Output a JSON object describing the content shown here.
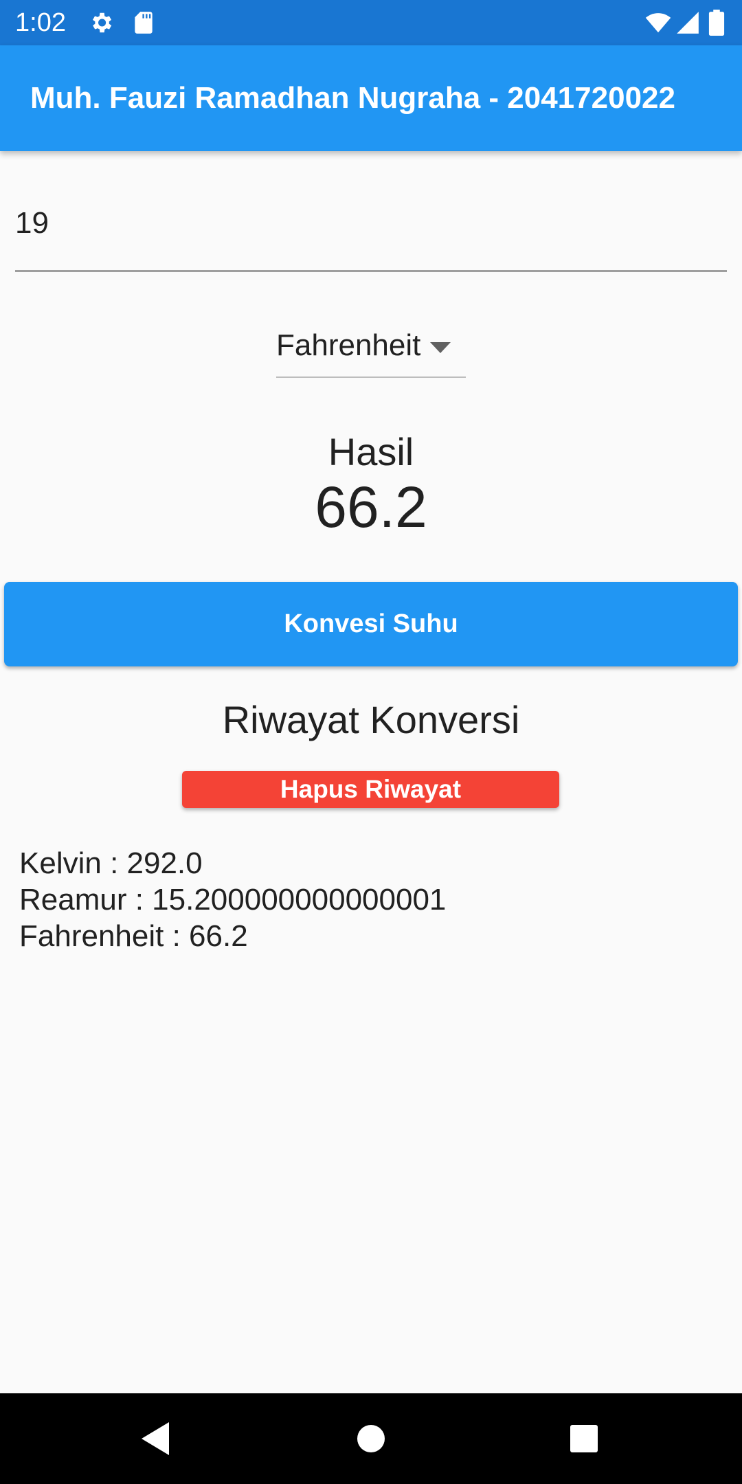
{
  "status_bar": {
    "time": "1:02",
    "icons": [
      "gear-icon",
      "sd-card-icon",
      "wifi-icon",
      "signal-icon",
      "battery-icon"
    ]
  },
  "app_bar": {
    "title": "Muh. Fauzi Ramadhan Nugraha - 2041720022"
  },
  "input": {
    "value": "19"
  },
  "dropdown": {
    "selected": "Fahrenheit"
  },
  "result": {
    "label": "Hasil",
    "value": "66.2"
  },
  "convert_button": {
    "label": "Konvesi Suhu"
  },
  "history": {
    "title": "Riwayat Konversi",
    "clear_label": "Hapus Riwayat",
    "items": [
      "Kelvin : 292.0",
      "Reamur : 15.200000000000001",
      "Fahrenheit : 66.2"
    ]
  },
  "colors": {
    "primary": "#2196f3",
    "status_bar": "#1976d2",
    "danger": "#f44336",
    "background": "#fafafa"
  },
  "nav_bar": {
    "icons": [
      "back-icon",
      "home-icon",
      "recents-icon"
    ]
  }
}
